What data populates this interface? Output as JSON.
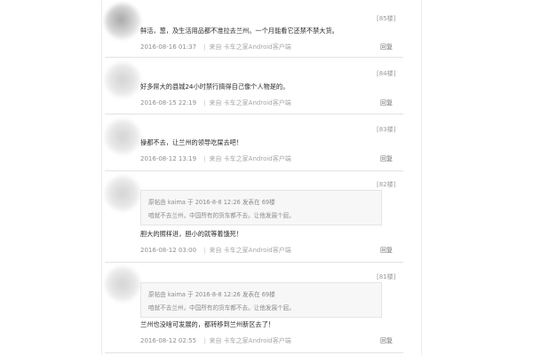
{
  "posts": [
    {
      "floor": "[85楼]",
      "text": "鲜活，葱，及生活用品都不准拉去兰州。一个月能看它还禁不禁大货。",
      "date": "2016-08-16 01:37",
      "source": "来自 卡车之家Android客户端",
      "reply": "回复"
    },
    {
      "floor": "[84楼]",
      "text": "好多屌大的县城24小时禁行搞得自己像个人物是的。",
      "date": "2016-08-15 22:19",
      "source": "来自 卡车之家Android客户端",
      "reply": "回复"
    },
    {
      "floor": "[83楼]",
      "text": "操都不去，让兰州的领导吃屎去吧！",
      "date": "2016-08-12 13:19",
      "source": "来自 卡车之家Android客户端",
      "reply": "回复"
    },
    {
      "floor": "[82楼]",
      "quote_header": "原帖由 kaima 于 2016-8-8 12:26 发表在 69楼",
      "quote_text": "咱就不去兰州，中国所有的货车都不去。让他发展个屁。",
      "text": "胆大的照样进，胆小的就等着饿死！",
      "date": "2016-08-12 03:00",
      "source": "来自 卡车之家Android客户端",
      "reply": "回复"
    },
    {
      "floor": "[81楼]",
      "quote_header": "原帖由 kaima 于 2016-8-8 12:26 发表在 69楼",
      "quote_text": "咱就不去兰州，中国所有的货车都不去。让他发展个屁。",
      "text": "兰州也没啥可发展的，都转移到兰州新区去了！",
      "date": "2016-08-12 02:55",
      "source": "来自 卡车之家Android客户端",
      "reply": "回复"
    }
  ],
  "separator": "|"
}
